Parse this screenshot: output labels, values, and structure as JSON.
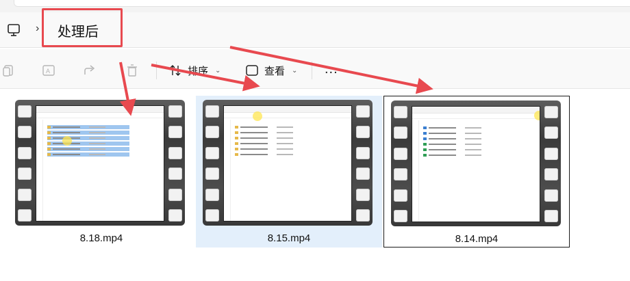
{
  "address": {
    "crumb": "处理后"
  },
  "toolbar": {
    "sort_label": "排序",
    "view_label": "查看",
    "more_label": "..."
  },
  "files": [
    {
      "name": "8.18.mp4"
    },
    {
      "name": "8.15.mp4"
    },
    {
      "name": "8.14.mp4"
    }
  ],
  "colors": {
    "annotation": "#e8494f",
    "selection": "#e3effb"
  },
  "icons": [
    "pc-icon",
    "chevron-right-icon",
    "copy-icon",
    "rename-icon",
    "share-icon",
    "delete-icon",
    "sort-icon",
    "view-icon",
    "chevron-down-icon",
    "more-icon",
    "video-thumbnail-icon"
  ]
}
